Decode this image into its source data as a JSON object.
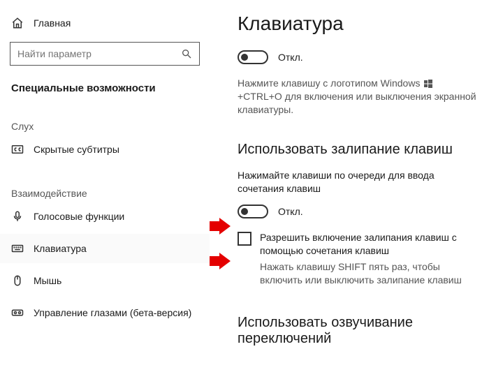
{
  "sidebar": {
    "home_label": "Главная",
    "search_placeholder": "Найти параметр",
    "section_title": "Специальные возможности",
    "group_hearing": "Слух",
    "group_interaction": "Взаимодействие",
    "items": {
      "closed_captions": "Скрытые субтитры",
      "speech": "Голосовые функции",
      "keyboard": "Клавиатура",
      "mouse": "Мышь",
      "eye_control": "Управление глазами (бета-версия)"
    }
  },
  "main": {
    "title": "Клавиатура",
    "toggle_off_1": "Откл.",
    "desc_before": "Нажмите клавишу с логотипом Windows",
    "desc_after": "+CTRL+O для включения или выключения экранной клавиатуры.",
    "sticky_heading": "Использовать залипание клавиш",
    "sticky_desc": "Нажимайте клавиши по очереди для ввода сочетания клавиш",
    "toggle_off_2": "Откл.",
    "checkbox_label": "Разрешить включение залипания клавиш с помощью сочетания клавиш",
    "checkbox_hint": "Нажать клавишу SHIFT пять раз, чтобы включить или выключить залипание клавиш",
    "toggle_keys_heading": "Использовать озвучивание переключений"
  }
}
